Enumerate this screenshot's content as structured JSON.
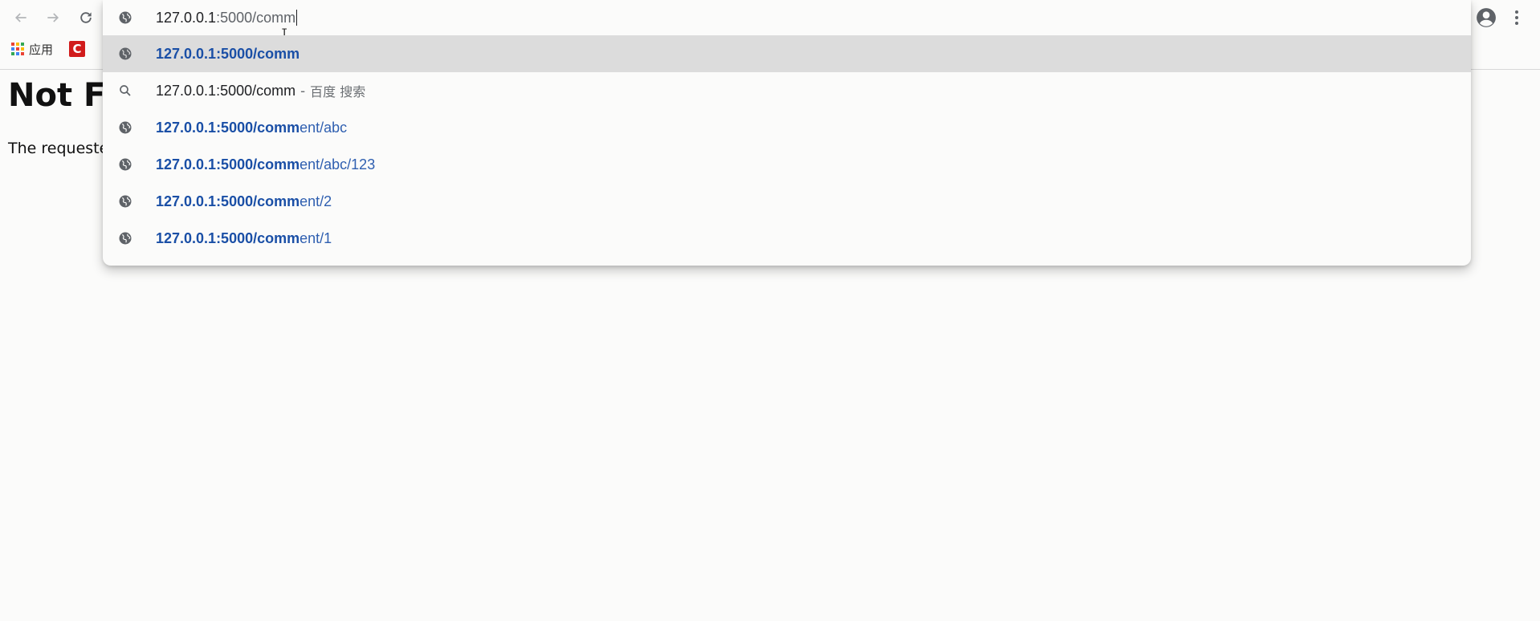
{
  "toolbar": {
    "back_icon": "arrow-left-icon",
    "forward_icon": "arrow-right-icon",
    "reload_icon": "reload-icon",
    "profile_icon": "account-circle-icon",
    "menu_icon": "more-vert-icon"
  },
  "bookmarks": {
    "apps_label": "应用",
    "c_label": "C"
  },
  "omnibox": {
    "input_host": "127.0.0.1",
    "input_rest": ":5000/comm",
    "suggestions": [
      {
        "type": "url",
        "icon": "globe-icon",
        "match": "127.0.0.1:5000/comm",
        "rest": "",
        "selected": true
      },
      {
        "type": "search",
        "icon": "search-icon",
        "match": "127.0.0.1:5000/comm",
        "sep": "-",
        "engine": "百度 搜索",
        "selected": false
      },
      {
        "type": "url",
        "icon": "globe-icon",
        "match": "127.0.0.1:5000/comm",
        "rest": "ent/abc",
        "selected": false
      },
      {
        "type": "url",
        "icon": "globe-icon",
        "match": "127.0.0.1:5000/comm",
        "rest": "ent/abc/123",
        "selected": false
      },
      {
        "type": "url",
        "icon": "globe-icon",
        "match": "127.0.0.1:5000/comm",
        "rest": "ent/2",
        "selected": false
      },
      {
        "type": "url",
        "icon": "globe-icon",
        "match": "127.0.0.1:5000/comm",
        "rest": "ent/1",
        "selected": false
      }
    ]
  },
  "page": {
    "title": "Not Fo",
    "text": "The requeste"
  },
  "colors": {
    "match_blue": "#1a4fa6",
    "selected_row": "#dcdcdc"
  }
}
